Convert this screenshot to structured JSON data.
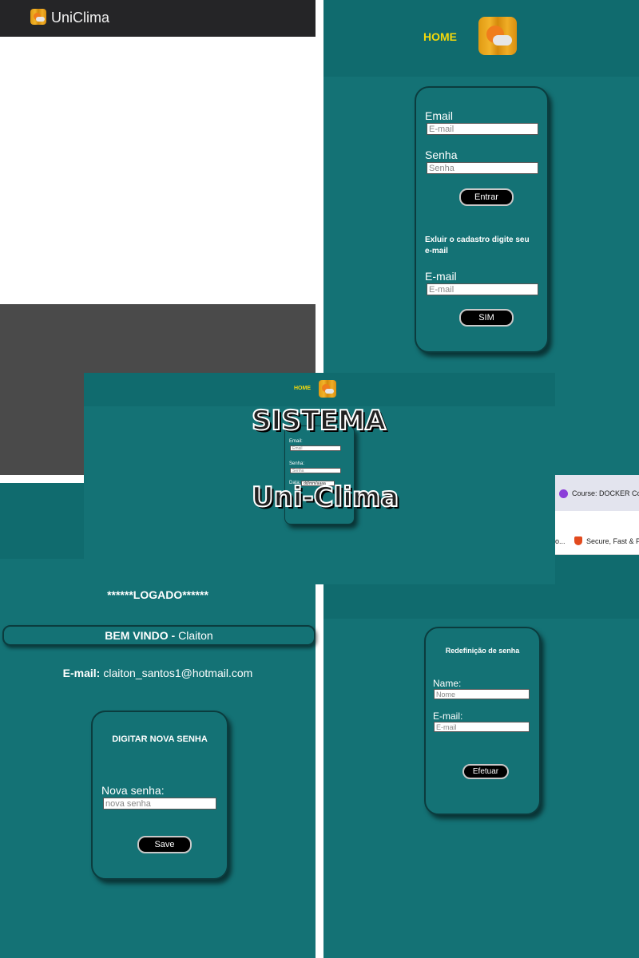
{
  "top_left": {
    "app_name": "UniClima"
  },
  "login_panel": {
    "nav_home": "HOME",
    "email_label": "Email",
    "email_placeholder": "E-mail",
    "password_label": "Senha",
    "password_placeholder": "Senha",
    "enter_button": "Entrar",
    "delete_text": "Exluir o cadastro digite seu e-mail",
    "delete_email_label": "E-mail",
    "delete_email_placeholder": "E-mail",
    "yes_button": "SIM"
  },
  "register_panel": {
    "nav_home": "HOME",
    "title_line1": "SISTEMA",
    "title_line2": "Uni-Clima",
    "email_label": "Email:",
    "email_placeholder": "Email",
    "password_label": "Senha:",
    "password_placeholder": "Senha",
    "date_label": "Data:",
    "date_value": "dd/mm/aaaa"
  },
  "logged_panel": {
    "logged_text": "******LOGADO******",
    "welcome_prefix": "BEM VINDO -",
    "user_name": "Claiton",
    "email_prefix": "E-mail:",
    "email_value": "claiton_santos1@hotmail.com",
    "card_title": "DIGITAR NOVA SENHA",
    "new_password_label": "Nova senha:",
    "new_password_placeholder": "nova senha",
    "save_button": "Save"
  },
  "reset_panel": {
    "browser_tab": "Course: DOCKER Con",
    "bookmark_left": "o...",
    "bookmark_right": "Secure, Fast & Pr",
    "card_title": "Redefinição de senha",
    "name_label": "Name:",
    "name_placeholder": "Nome",
    "email_label": "E-mail:",
    "email_placeholder": "E-mail",
    "submit_button": "Efetuar"
  },
  "colors": {
    "teal": "#147275",
    "card_border": "#0b3c3e",
    "nav_yellow": "#f5d90a"
  }
}
